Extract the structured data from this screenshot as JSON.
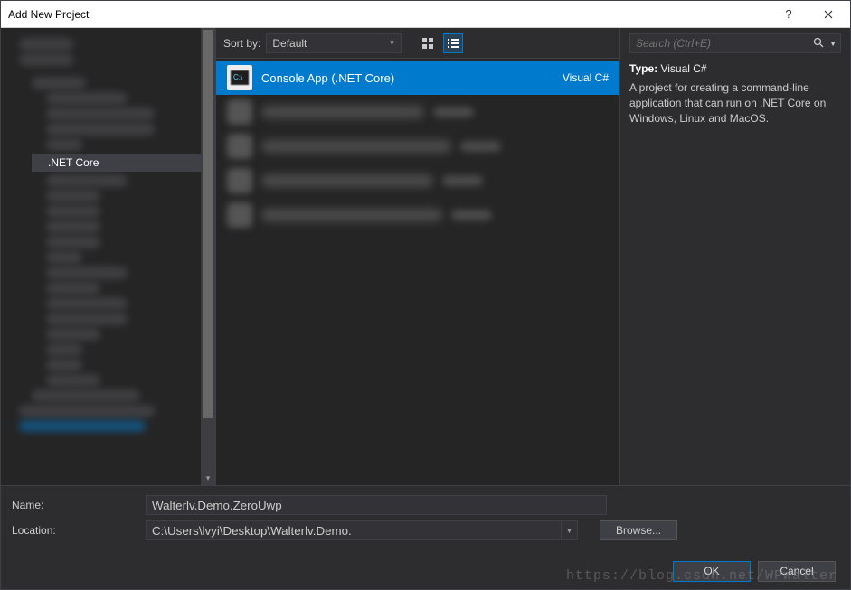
{
  "titlebar": {
    "title": "Add New Project",
    "help": "?",
    "close": "✕"
  },
  "sidebar": {
    "selected_label": ".NET Core"
  },
  "toolbar": {
    "sortby_label": "Sort by:",
    "sortby_value": "Default"
  },
  "templates": {
    "selected": {
      "name": "Console App (.NET Core)",
      "language": "Visual C#"
    }
  },
  "detail": {
    "search_placeholder": "Search (Ctrl+E)",
    "type_label": "Type:",
    "type_value": "Visual C#",
    "description": "A project for creating a command-line application that can run on .NET Core on Windows, Linux and MacOS."
  },
  "bottom": {
    "name_label": "Name:",
    "name_value": "Walterlv.Demo.ZeroUwp",
    "location_label": "Location:",
    "location_value": "C:\\Users\\lvyi\\Desktop\\Walterlv.Demo.",
    "browse_label": "Browse..."
  },
  "footer": {
    "ok_label": "OK",
    "cancel_label": "Cancel",
    "watermark": "https://blog.csdn.net/WPwalter"
  }
}
